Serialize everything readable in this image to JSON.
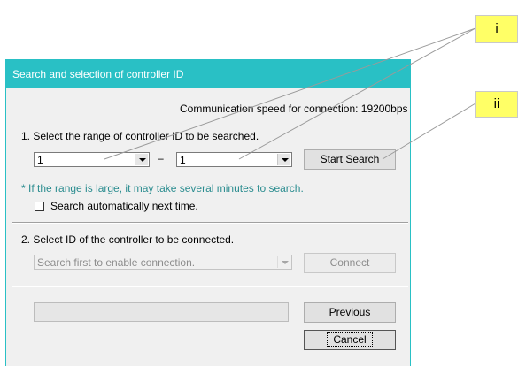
{
  "window": {
    "title": "Search and selection of controller ID",
    "speed_text": "Communication speed for connection: 19200bps"
  },
  "section1": {
    "heading": "1. Select the range of controller ID to be searched.",
    "range_from": "1",
    "range_separator": "–",
    "range_to": "1",
    "start_search_label": "Start Search",
    "note": "* If the range is large, it may take several minutes to search.",
    "auto_search_label": "Search automatically next time.",
    "auto_search_checked": false
  },
  "section2": {
    "heading": "2. Select ID of the controller to be connected.",
    "id_select_value": "Search first to enable connection.",
    "connect_label": "Connect"
  },
  "footer": {
    "previous_label": "Previous",
    "cancel_label": "Cancel"
  },
  "callouts": {
    "i": "i",
    "ii": "ii"
  },
  "colors": {
    "titlebar": "#29c0c5",
    "note_text": "#2a8c8f",
    "callout_bg": "#ffff66"
  }
}
